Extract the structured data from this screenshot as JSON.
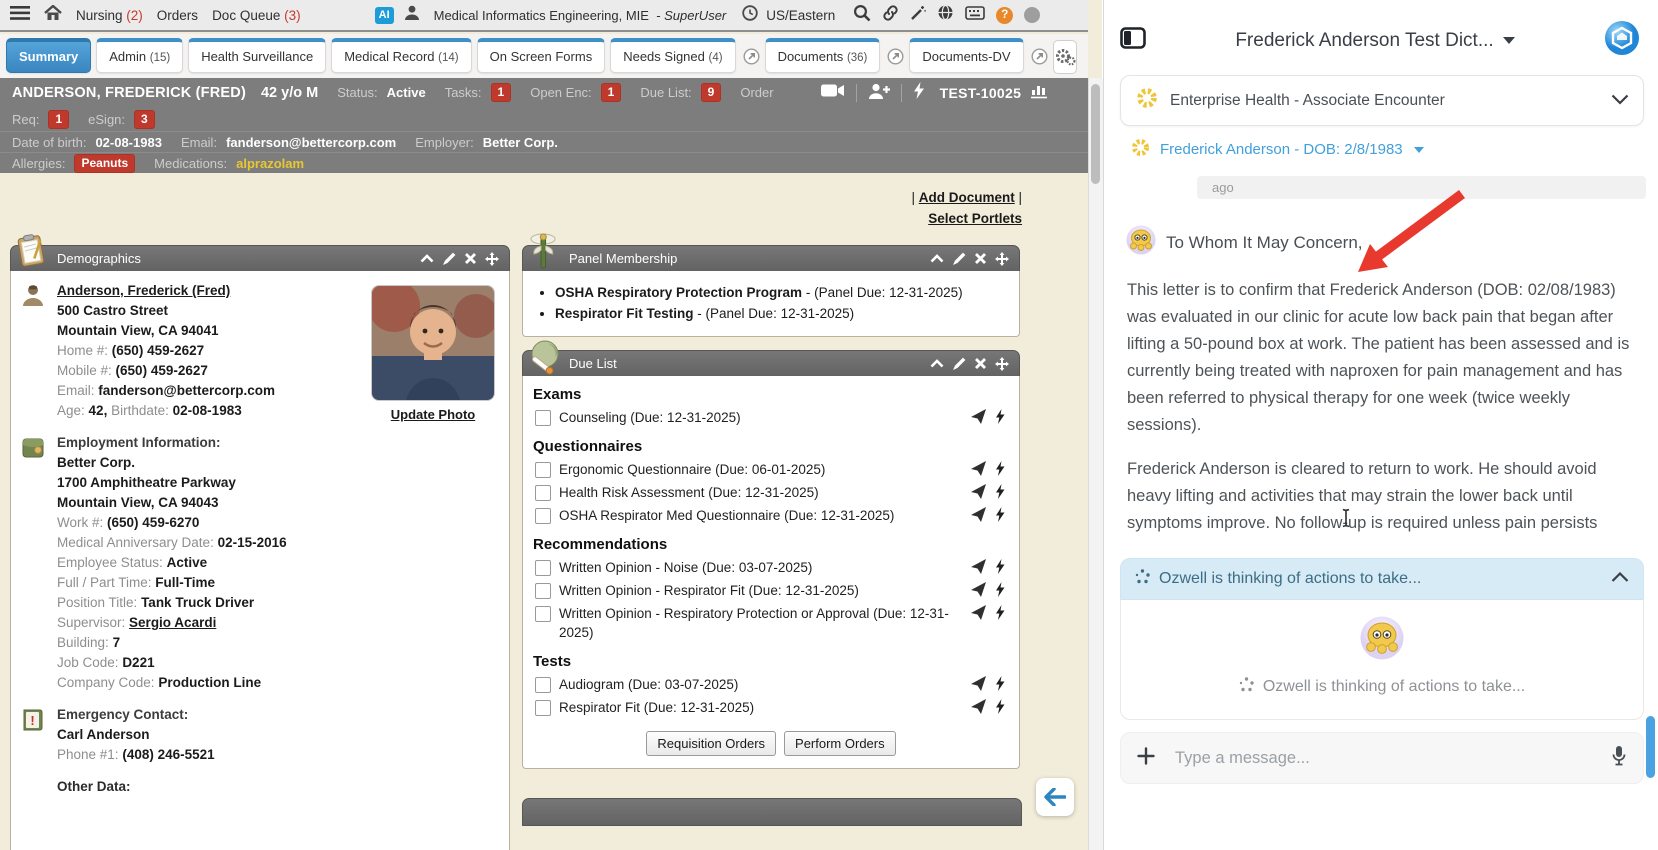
{
  "topbar": {
    "nav": [
      {
        "label": "Nursing",
        "count": "(2)"
      },
      {
        "label": "Orders",
        "count": ""
      },
      {
        "label": "Doc Queue",
        "count": "(3)"
      }
    ],
    "ai_badge": "AI",
    "org_name": "Medical Informatics Engineering, MIE",
    "user_role": "- SuperUser",
    "timezone": "US/Eastern"
  },
  "tabs": [
    {
      "label": "Summary"
    },
    {
      "label": "Admin",
      "count": "(15)"
    },
    {
      "label": "Health Surveillance"
    },
    {
      "label": "Medical Record",
      "count": "(14)"
    },
    {
      "label": "On Screen Forms"
    },
    {
      "label": "Needs Signed",
      "count": "(4)"
    },
    {
      "label": "Documents",
      "count": "(36)"
    },
    {
      "label": "Documents-DV"
    }
  ],
  "patient_header": {
    "name": "ANDERSON, FREDERICK (FRED)",
    "age_sex": "42 y/o M",
    "status_label": "Status:",
    "status_value": "Active",
    "tasks_label": "Tasks:",
    "tasks_count": "1",
    "open_enc_label": "Open Enc:",
    "open_enc_count": "1",
    "due_list_label": "Due List:",
    "due_list_count": "9",
    "order_label": "Order",
    "patient_id": "TEST-10025",
    "req_label": "Req:",
    "req_count": "1",
    "esign_label": "eSign:",
    "esign_count": "3",
    "dob_label": "Date of birth:",
    "dob_value": "02-08-1983",
    "email_label": "Email:",
    "email_value": "fanderson@bettercorp.com",
    "employer_label": "Employer:",
    "employer_value": "Better Corp.",
    "allergies_label": "Allergies:",
    "allergies_value": "Peanuts",
    "medications_label": "Medications:",
    "medications_value": "alprazolam"
  },
  "page_actions": {
    "sep": "|",
    "add_document": "Add Document",
    "select_portlets": "Select Portlets"
  },
  "demographics": {
    "title": "Demographics",
    "name_link": "Anderson, Frederick (Fred)",
    "address_line1": "500 Castro Street",
    "address_line2": "Mountain View, CA 94041",
    "home_label": "Home #:",
    "home_value": "(650) 459-2627",
    "mobile_label": "Mobile #:",
    "mobile_value": "(650) 459-2627",
    "email_label": "Email:",
    "email_value": "fanderson@bettercorp.com",
    "age_label": "Age:",
    "age_value": "42,",
    "birthdate_label": "Birthdate:",
    "birthdate_value": "02-08-1983",
    "update_photo": "Update Photo",
    "employment": {
      "heading": "Employment Information:",
      "company": "Better Corp.",
      "address_line1": "1700 Amphitheatre Parkway",
      "address_line2": "Mountain View, CA 94043",
      "work_label": "Work #:",
      "work_value": "(650) 459-6270",
      "anniversary_label": "Medical Anniversary Date:",
      "anniversary_value": "02-15-2016",
      "status_label": "Employee Status:",
      "status_value": "Active",
      "fulltime_label": "Full / Part Time:",
      "fulltime_value": "Full-Time",
      "position_label": "Position Title:",
      "position_value": "Tank Truck Driver",
      "supervisor_label": "Supervisor:",
      "supervisor_value": "Sergio Acardi",
      "building_label": "Building:",
      "building_value": "7",
      "jobcode_label": "Job Code:",
      "jobcode_value": "D221",
      "companycode_label": "Company Code:",
      "companycode_value": "Production Line"
    },
    "emergency": {
      "heading": "Emergency Contact:",
      "name": "Carl Anderson",
      "phone_label": "Phone #1:",
      "phone_value": "(408) 246-5521"
    },
    "other_data_heading": "Other Data:"
  },
  "panel_membership": {
    "title": "Panel Membership",
    "items": [
      {
        "name": "OSHA Respiratory Protection Program",
        "due": "- (Panel Due: 12-31-2025)"
      },
      {
        "name": "Respirator Fit Testing",
        "due": "- (Panel Due: 12-31-2025)"
      }
    ]
  },
  "due_list": {
    "title": "Due List",
    "sections": [
      {
        "heading": "Exams",
        "items": [
          {
            "label": "Counseling (Due: 12-31-2025)"
          }
        ]
      },
      {
        "heading": "Questionnaires",
        "items": [
          {
            "label": "Ergonomic Questionnaire (Due: 06-01-2025)"
          },
          {
            "label": "Health Risk Assessment (Due: 12-31-2025)"
          },
          {
            "label": "OSHA Respirator Med Questionnaire (Due: 12-31-2025)"
          }
        ]
      },
      {
        "heading": "Recommendations",
        "items": [
          {
            "label": "Written Opinion - Noise (Due: 03-07-2025)"
          },
          {
            "label": "Written Opinion - Respirator Fit (Due: 12-31-2025)"
          },
          {
            "label": "Written Opinion - Respiratory Protection or Approval (Due: 12-31-2025)"
          }
        ]
      },
      {
        "heading": "Tests",
        "items": [
          {
            "label": "Audiogram (Due: 03-07-2025)"
          },
          {
            "label": "Respirator Fit (Due: 12-31-2025)"
          }
        ]
      }
    ],
    "requisition_button": "Requisition Orders",
    "perform_button": "Perform Orders"
  },
  "chat_panel": {
    "title": "Frederick Anderson Test Dict...",
    "encounter_selector": "Enterprise Health - Associate Encounter",
    "patient_link": "Frederick Anderson - DOB: 2/8/1983",
    "bubble_meta": "ago",
    "greeting": "To Whom It May Concern,",
    "paragraph1": "This letter is to confirm that Frederick Anderson (DOB: 02/08/1983) was evaluated in our clinic for acute low back pain that began after lifting a 50-pound box at work. The patient has been assessed and is currently being treated with naproxen for pain management and has been referred to physical therapy for one week (twice weekly sessions).",
    "paragraph2": "Frederick Anderson is cleared to return to work. He should avoid heavy lifting and activities that may strain the lower back until symptoms improve. No follow-up is required unless pain persists",
    "thinking_banner": "Ozwell is thinking of actions to take...",
    "thinking_status": "Ozwell is thinking of actions to take...",
    "input_placeholder": "Type a message..."
  },
  "colors": {
    "accent_blue": "#3f90c9",
    "badge_red": "#bf3a2d",
    "ai_badge_blue": "#1d9cd8",
    "content_beige": "#f2ecda",
    "header_gray": "#7d7d7d",
    "banner_blue": "#d7ebf7",
    "medications_yellow": "#e8c832",
    "arrow_red": "#e8392e"
  }
}
